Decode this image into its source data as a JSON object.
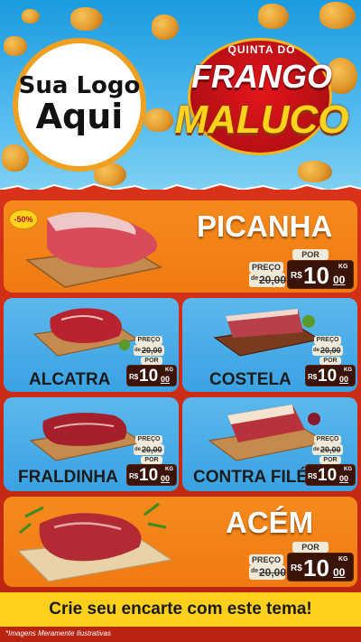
{
  "header": {
    "logo_line1": "Sua Logo",
    "logo_line2": "Aqui",
    "brand_top": "QUINTA DO",
    "brand_mid": "FRANGO",
    "brand_bottom": "MALUCO"
  },
  "products": {
    "picanha": {
      "name": "PICANHA",
      "badge": "-50%",
      "label_from": "PREÇO",
      "label_to": "POR",
      "old_prefix": "de",
      "old_value": "20,00",
      "currency": "R$",
      "new_int": "10",
      "new_dec": "00",
      "unit": "KG"
    },
    "alcatra": {
      "name": "ALCATRA",
      "label_from": "PREÇO",
      "label_to": "POR",
      "old_prefix": "de",
      "old_value": "20,00",
      "currency": "R$",
      "new_int": "10",
      "new_dec": "00",
      "unit": "KG"
    },
    "costela": {
      "name": "COSTELA",
      "label_from": "PREÇO",
      "label_to": "POR",
      "old_prefix": "de",
      "old_value": "20,00",
      "currency": "R$",
      "new_int": "10",
      "new_dec": "00",
      "unit": "KG"
    },
    "fraldinha": {
      "name": "FRALDINHA",
      "label_from": "PREÇO",
      "label_to": "POR",
      "old_prefix": "de",
      "old_value": "20,00",
      "currency": "R$",
      "new_int": "10",
      "new_dec": "00",
      "unit": "KG"
    },
    "contra_file": {
      "name": "CONTRA FILÉ",
      "label_from": "PREÇO",
      "label_to": "POR",
      "old_prefix": "de",
      "old_value": "20,00",
      "currency": "R$",
      "new_int": "10",
      "new_dec": "00",
      "unit": "KG"
    },
    "acem": {
      "name": "ACÉM",
      "label_from": "PREÇO",
      "label_to": "POR",
      "old_prefix": "de",
      "old_value": "20,00",
      "currency": "R$",
      "new_int": "10",
      "new_dec": "00",
      "unit": "KG"
    }
  },
  "cta": "Crie seu encarte com este tema!",
  "disclaimer": "*Imagens Meramente Ilustrativas",
  "colors": {
    "orange_card": "#f58a1c",
    "blue_card": "#4fb0e8",
    "body_red": "#c62a14",
    "cta_yellow": "#ffcf1e",
    "price_dark": "#3a1408"
  },
  "icons": [
    "chicken-nugget-icon",
    "meat-cut-icon",
    "wooden-board-icon"
  ]
}
